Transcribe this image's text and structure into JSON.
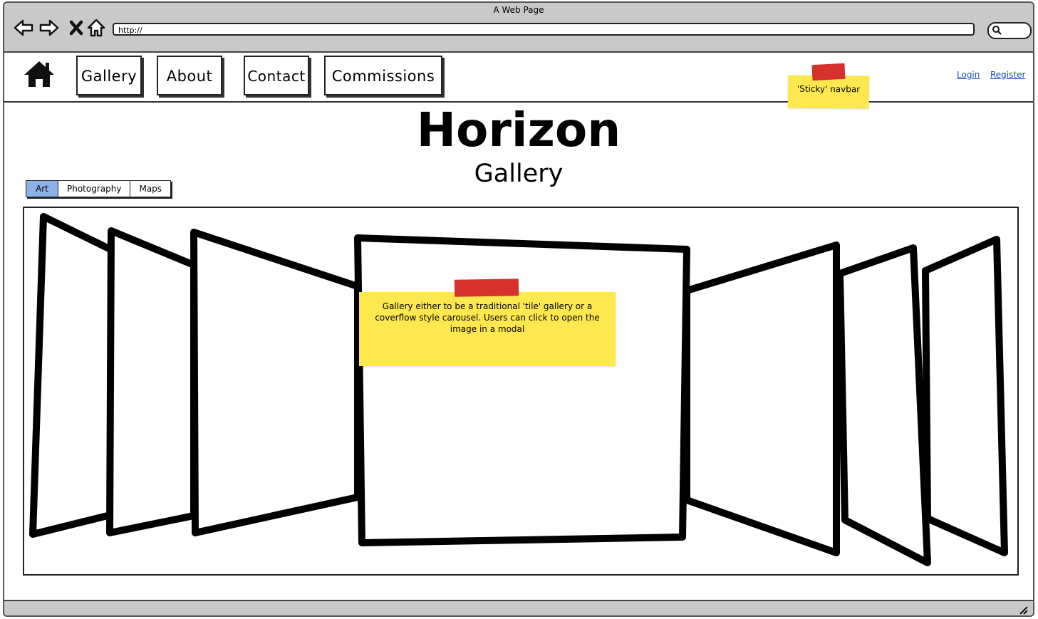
{
  "browser": {
    "window_title": "A Web Page",
    "url": "http://"
  },
  "navbar": {
    "items": [
      {
        "label": "Gallery"
      },
      {
        "label": "About"
      },
      {
        "label": "Contact"
      },
      {
        "label": "Commissions"
      }
    ],
    "login_label": "Login",
    "register_label": "Register",
    "note": "'Sticky' navbar"
  },
  "page": {
    "title": "Horizon",
    "subtitle": "Gallery"
  },
  "category_tabs": [
    {
      "label": "Art",
      "active": true
    },
    {
      "label": "Photography",
      "active": false
    },
    {
      "label": "Maps",
      "active": false
    }
  ],
  "gallery": {
    "note": "Gallery either to be a traditional 'tile' gallery or a coverflow style carousel. Users can click to open the image in a modal"
  },
  "colors": {
    "sticky_note": "#fde84f",
    "tape": "#d6322b",
    "active_tab": "#8cb0e8",
    "link": "#1a4fbf"
  }
}
